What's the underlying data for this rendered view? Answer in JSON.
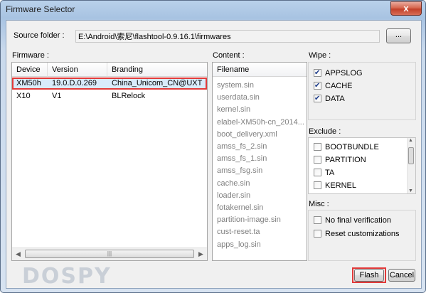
{
  "window": {
    "title": "Firmware Selector",
    "close_glyph": "x"
  },
  "source": {
    "label": "Source folder :",
    "value": "E:\\Android\\索尼\\flashtool-0.9.16.1\\firmwares",
    "browse_label": "..."
  },
  "firmware": {
    "label": "Firmware :",
    "columns": [
      "Device",
      "Version",
      "Branding"
    ],
    "rows": [
      {
        "device": "XM50h",
        "version": "19.0.D.0.269",
        "branding": "China_Unicom_CN@UXT",
        "selected": true
      },
      {
        "device": "X10",
        "version": "V1",
        "branding": "BLRelock",
        "selected": false
      }
    ]
  },
  "content": {
    "label": "Content :",
    "header": "Filename",
    "files": [
      "system.sin",
      "userdata.sin",
      "kernel.sin",
      "elabel-XM50h-cn_2014...",
      "boot_delivery.xml",
      "amss_fs_2.sin",
      "amss_fs_1.sin",
      "amss_fsg.sin",
      "cache.sin",
      "loader.sin",
      "fotakernel.sin",
      "partition-image.sin",
      "cust-reset.ta",
      "apps_log.sin"
    ]
  },
  "wipe": {
    "label": "Wipe :",
    "items": [
      {
        "label": "APPSLOG",
        "checked": true
      },
      {
        "label": "CACHE",
        "checked": true
      },
      {
        "label": "DATA",
        "checked": true
      }
    ]
  },
  "exclude": {
    "label": "Exclude :",
    "items": [
      {
        "label": "BOOTBUNDLE",
        "checked": false
      },
      {
        "label": "PARTITION",
        "checked": false
      },
      {
        "label": "TA",
        "checked": false
      },
      {
        "label": "KERNEL",
        "checked": false
      }
    ]
  },
  "misc": {
    "label": "Misc :",
    "items": [
      {
        "label": "No final verification",
        "checked": false
      },
      {
        "label": "Reset customizations",
        "checked": false
      }
    ]
  },
  "buttons": {
    "flash": "Flash",
    "cancel": "Cancel"
  },
  "watermark": "DOSPY",
  "colors": {
    "selection_highlight": "#e23a3a",
    "selected_row": "#d9ebfb"
  }
}
